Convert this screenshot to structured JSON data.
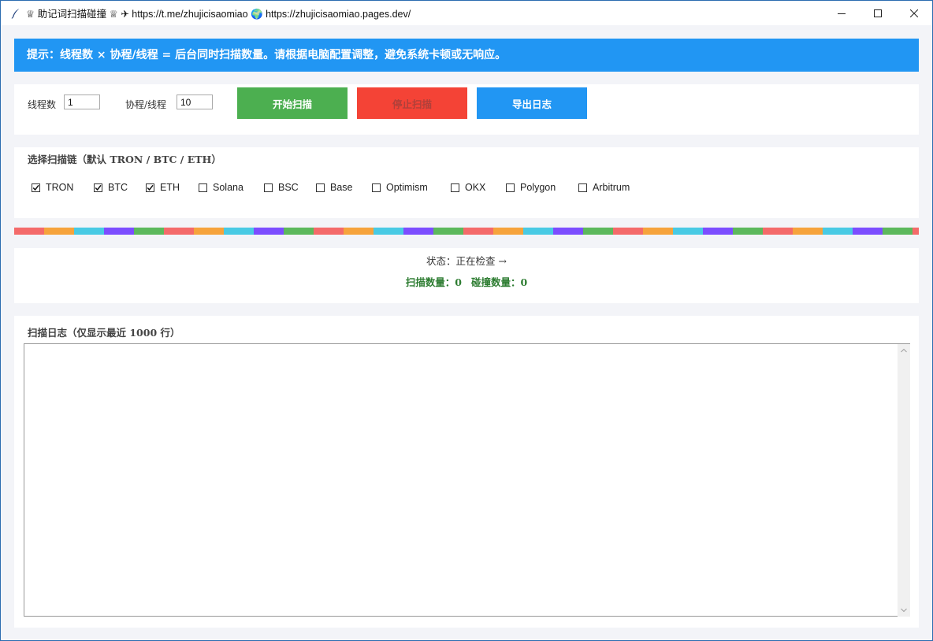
{
  "window": {
    "title": "♕ 助记词扫描碰撞 ♕ ✈ https://t.me/zhujicisaomiao 🌍 https://zhujicisaomiao.pages.dev/",
    "app_icon": "feather-icon",
    "controls": [
      "minimize-icon",
      "maximize-icon",
      "close-icon"
    ]
  },
  "tip": {
    "text": "提示：线程数 × 协程/线程 = 后台同时扫描数量。请根据电脑配置调整，避免系统卡顿或无响应。",
    "background": "#2196f3"
  },
  "controls": {
    "threads_label": "线程数",
    "threads_value": "1",
    "coroutines_label": "协程/线程",
    "coroutines_value": "10",
    "start_label": "开始扫描",
    "stop_label": "停止扫描",
    "export_label": "导出日志",
    "start_color": "#4caf50",
    "stop_color": "#f44336",
    "export_color": "#2196f3"
  },
  "chains": {
    "title": "选择扫描链（默认 TRON / BTC / ETH）",
    "items": [
      {
        "label": "TRON",
        "checked": true
      },
      {
        "label": "BTC",
        "checked": true
      },
      {
        "label": "ETH",
        "checked": true
      },
      {
        "label": "Solana",
        "checked": false
      },
      {
        "label": "BSC",
        "checked": false
      },
      {
        "label": "Base",
        "checked": false
      },
      {
        "label": "Optimism",
        "checked": false
      },
      {
        "label": "OKX",
        "checked": false
      },
      {
        "label": "Polygon",
        "checked": false
      },
      {
        "label": "Arbitrum",
        "checked": false
      }
    ]
  },
  "stripe_colors": [
    "#f46a6a",
    "#f6a33c",
    "#48cae4",
    "#7c4dff",
    "#5cb85c"
  ],
  "status": {
    "text": "状态：正在检查 →",
    "scan_count_label": "扫描数量：",
    "scan_count": "0",
    "hit_count_label": "碰撞数量：",
    "hit_count": "0",
    "count_color": "#2e7d32"
  },
  "log": {
    "title": "扫描日志（仅显示最近 1000 行）",
    "content": ""
  }
}
